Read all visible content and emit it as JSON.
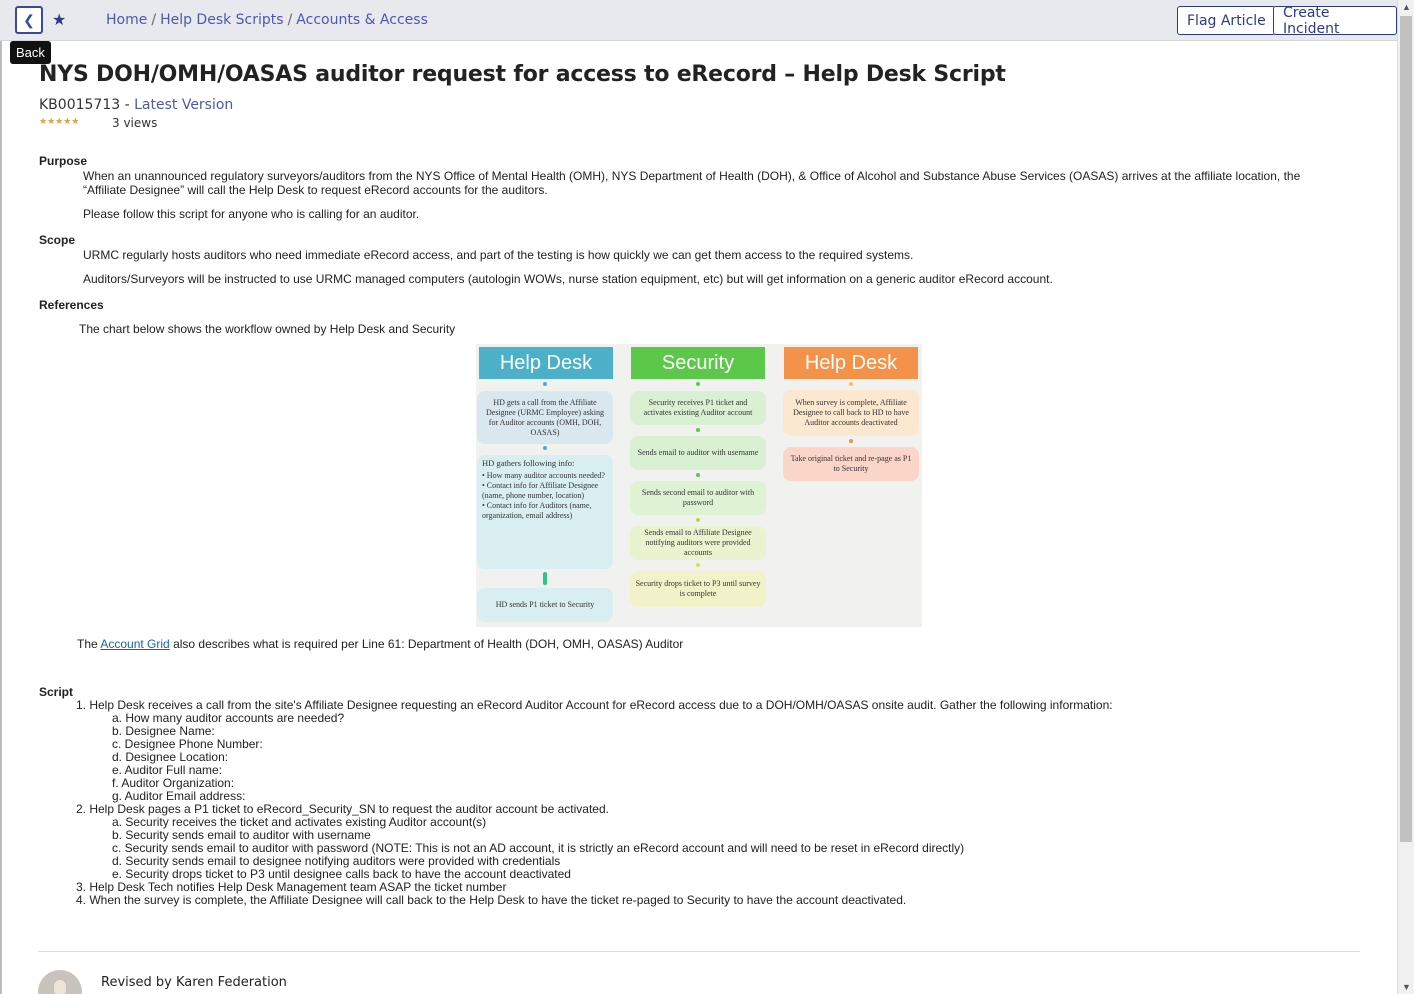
{
  "header": {
    "back_tooltip": "Back",
    "breadcrumbs": [
      "Home",
      "Help Desk Scripts",
      "Accounts & Access"
    ],
    "breadcrumb_separator": "/",
    "flag_label": "Flag Article",
    "create_label": "Create Incident"
  },
  "article": {
    "title": "NYS DOH/OMH/OASAS auditor request for access to eRecord – Help Desk Script",
    "kb_number": "KB0015713",
    "version_sep": "-",
    "version_label": "Latest Version",
    "rating_stars": "★★★★★",
    "views": "3 views"
  },
  "purpose": {
    "heading": "Purpose",
    "p1_line1": "When an unannounced regulatory surveyors/auditors from the NYS Office of Mental Health (OMH), NYS Department of Health (DOH), & Office of Alcohol and Substance Abuse Services (OASAS) arrives at the affiliate location, the",
    "p1_line2": "“Affiliate Designee” will call the Help Desk to request eRecord accounts for the auditors.",
    "p2": "Please follow this script for anyone who is calling for an auditor."
  },
  "scope": {
    "heading": "Scope",
    "p1": "URMC regularly hosts auditors who need immediate eRecord access, and part of the testing is how quickly we can get them access to the required systems.",
    "p2": "Auditors/Surveyors will be instructed to use URMC managed computers (autologin WOWs, nurse station equipment, etc) but will get information on a generic auditor eRecord account."
  },
  "references": {
    "heading": "References",
    "intro": "The chart below shows the workflow owned by Help Desk and Security",
    "grid_prefix": "The ",
    "grid_link": "Account Grid",
    "grid_suffix": " also describes what is required per Line 61: Department of Health (DOH, OMH, OASAS) Auditor"
  },
  "workflow": {
    "col1_title": "Help Desk",
    "col2_title": "Security",
    "col3_title": "Help Desk",
    "col1_colors": {
      "header": "#4bb0c8",
      "box": "#d8e8ee"
    },
    "col2_colors": {
      "header": "#5cc84a",
      "box": "#d9f0d2"
    },
    "col3_colors": {
      "header": "#f5924a",
      "box": "#fbe5cf"
    },
    "hd1": "HD gets a call from the Affiliate Designee (URMC Employee) asking for Auditor accounts (OMH, DOH, OASAS)",
    "hd2_title": "HD gathers following info:",
    "hd2_b1": "• How many auditor accounts needed?",
    "hd2_b2": "• Contact info for Affiliate Designee (name, phone number, location)",
    "hd2_b3": "• Contact info for Auditors (name, organization, email address)",
    "hd3": "HD sends P1 ticket to Security",
    "sec1": "Security receives P1 ticket and activates existing Auditor account",
    "sec2": "Sends email to auditor with username",
    "sec3": "Sends second email to auditor with password",
    "sec4": "Sends email to Affiliate Designee notifying auditors were provided accounts",
    "sec5": "Security drops ticket to P3 until survey is complete",
    "hd4": "When survey is complete, Affiliate Designee to call back to HD to have Auditor accounts deactivated",
    "hd5": "Take original ticket and re-page as P1 to Security"
  },
  "script": {
    "heading": "Script",
    "s1": "1. Help Desk receives a call from the site's Affiliate Designee requesting an eRecord Auditor Account for eRecord access due to a DOH/OMH/OASAS onsite audit. Gather the following information:",
    "s1a": "a. How many auditor accounts are needed?",
    "s1b": "b. Designee Name:",
    "s1c": "c. Designee Phone Number:",
    "s1d": "d. Designee Location:",
    "s1e": "e. Auditor Full name:",
    "s1f": "f. Auditor Organization:",
    "s1g": "g. Auditor Email address:",
    "s2": "2. Help Desk pages a P1 ticket to eRecord_Security_SN to request the auditor account be activated.",
    "s2a": "a. Security receives the ticket and activates existing Auditor account(s)",
    "s2b": "b. Security sends email to auditor with username",
    "s2c": "c. Security sends email to auditor with password (NOTE: This is not an AD account, it is strictly an eRecord account and will need to be reset in eRecord directly)",
    "s2d": "d. Security sends email to designee notifying auditors were provided with credentials",
    "s2e": "e. Security drops ticket to P3 until designee calls back to have the account deactivated",
    "s3": "3. Help Desk Tech notifies Help Desk Management team ASAP the ticket number",
    "s4": "4. When the survey is complete, the Affiliate Designee will call back to the Help Desk to have the ticket re-paged to Security to have the account deactivated."
  },
  "footer": {
    "revised": "Revised by Karen Federation"
  }
}
